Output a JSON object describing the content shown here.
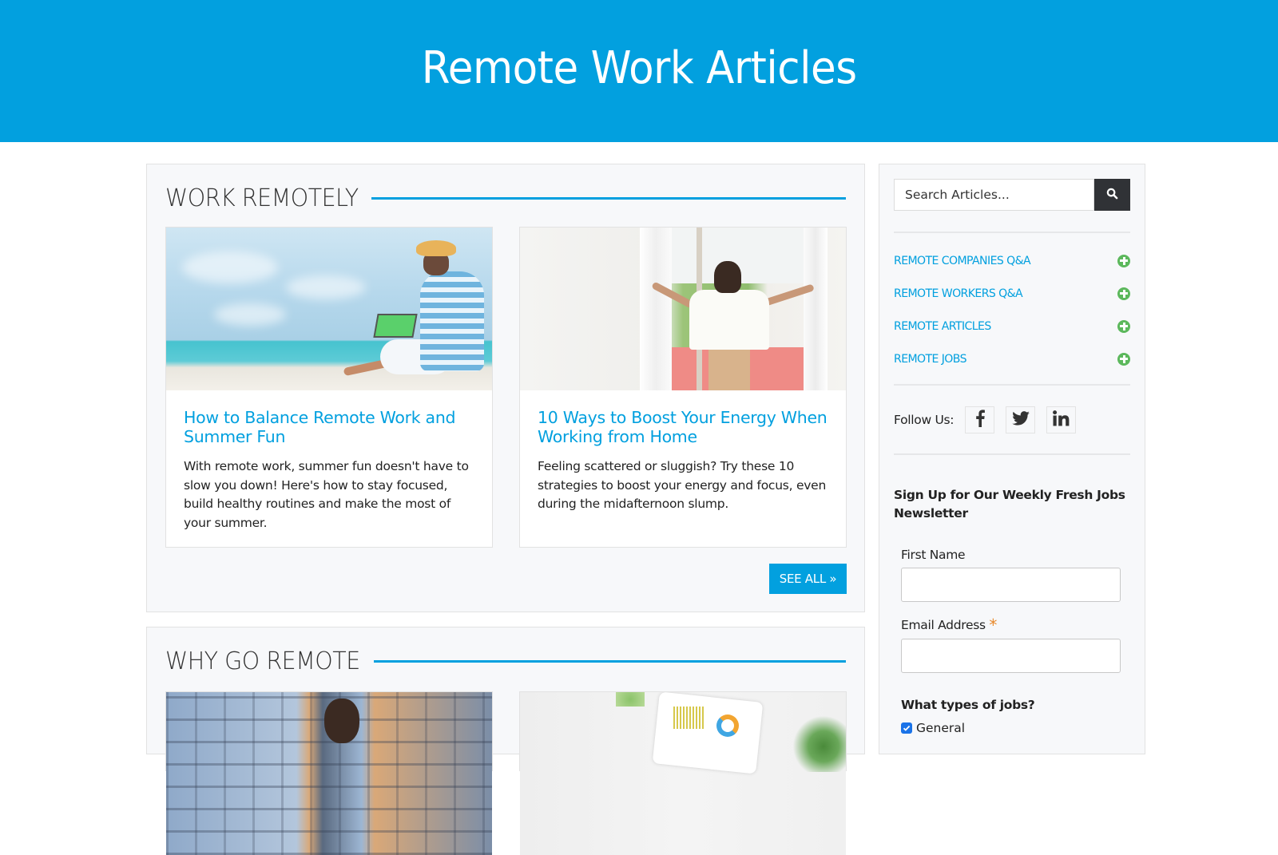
{
  "page": {
    "title": "Remote Work Articles"
  },
  "sections": [
    {
      "heading": "WORK REMOTELY",
      "articles": [
        {
          "title": "How to Balance Remote Work and Summer Fun",
          "description": "With remote work, summer fun doesn't have to slow you down! Here's how to stay focused, build healthy routines and make the most of your summer.",
          "image": "person-on-beach-with-laptop"
        },
        {
          "title": "10 Ways to Boost Your Energy When Working from Home",
          "description": "Feeling scattered or sluggish? Try these 10 strategies to boost your energy and focus, even during the midafternoon slump.",
          "image": "woman-opening-curtains"
        }
      ],
      "see_all_label": "SEE ALL »"
    },
    {
      "heading": "WHY GO REMOTE",
      "articles": [
        {
          "image": "man-in-front-of-building"
        },
        {
          "image": "laptop-with-charts-and-plant"
        }
      ]
    }
  ],
  "sidebar": {
    "search": {
      "placeholder": "Search Articles...",
      "value": "",
      "icon": "search-icon"
    },
    "links": [
      {
        "label": "REMOTE COMPANIES Q&A",
        "icon": "plus-circle-icon"
      },
      {
        "label": "REMOTE WORKERS Q&A",
        "icon": "plus-circle-icon"
      },
      {
        "label": "REMOTE ARTICLES",
        "icon": "plus-circle-icon"
      },
      {
        "label": "REMOTE JOBS",
        "icon": "plus-circle-icon"
      }
    ],
    "follow": {
      "label": "Follow Us:",
      "networks": [
        "facebook",
        "twitter",
        "linkedin"
      ]
    },
    "newsletter": {
      "title": "Sign Up for Our Weekly Fresh Jobs Newsletter",
      "first_name_label": "First Name",
      "first_name_value": "",
      "email_label": "Email Address",
      "email_required_mark": "*",
      "email_value": "",
      "jobs_question": "What types of jobs?",
      "options": [
        {
          "label": "General",
          "checked": true
        }
      ]
    }
  },
  "colors": {
    "brand_blue": "#02a0df",
    "search_button": "#303236",
    "plus_green": "#5cb85c",
    "required_orange": "#e8892b",
    "panel_bg": "#f7f8fa"
  }
}
